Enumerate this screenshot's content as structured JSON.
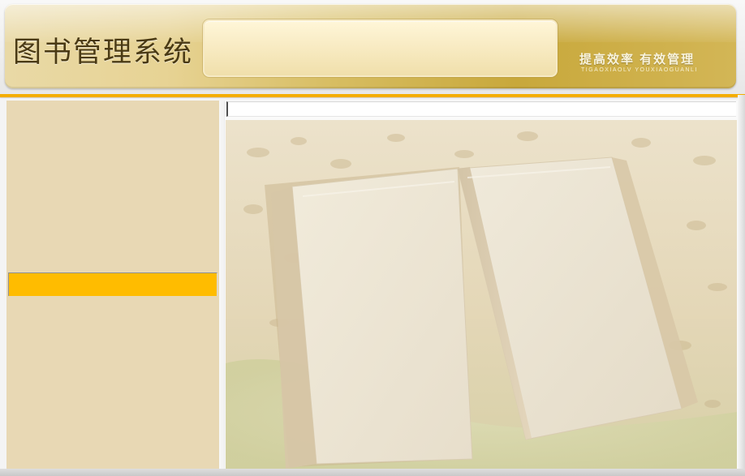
{
  "header": {
    "title": "图书管理系统",
    "slogan": "提高效率  有效管理",
    "slogan_pinyin": "TIGAOXIAOLV   YOUXIAOGUANLI"
  },
  "sidebar": {
    "selected_color": "#ffbc00",
    "panel_color": "#e8d8b4"
  },
  "main": {
    "hero_image": "open-stone-book"
  },
  "colors": {
    "accent": "#f4ad00",
    "banner_gold": "#d3b656"
  }
}
